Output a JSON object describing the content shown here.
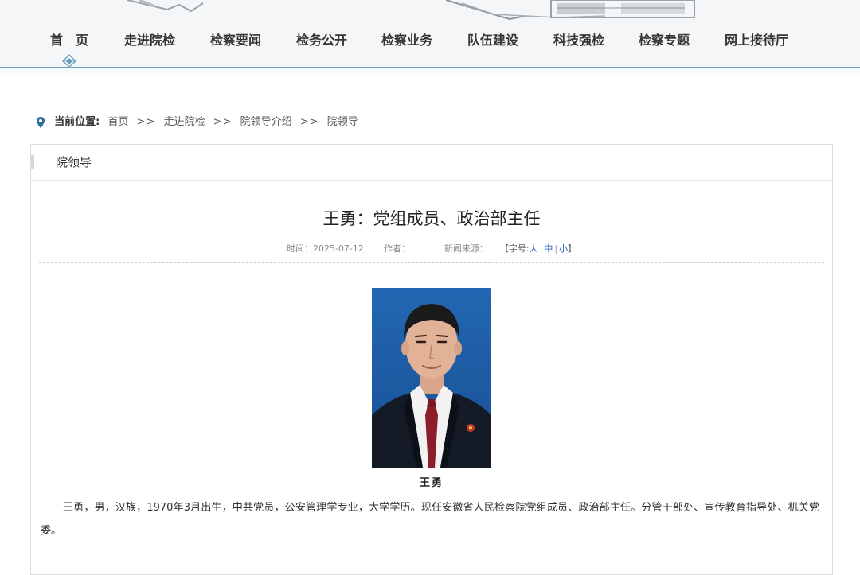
{
  "nav": {
    "items": [
      {
        "label": "首　页"
      },
      {
        "label": "走进院检"
      },
      {
        "label": "检察要闻"
      },
      {
        "label": "检务公开"
      },
      {
        "label": "检察业务"
      },
      {
        "label": "队伍建设"
      },
      {
        "label": "科技强检"
      },
      {
        "label": "检察专题"
      },
      {
        "label": "网上接待厅"
      }
    ]
  },
  "breadcrumb": {
    "label": "当前位置:",
    "items": [
      "首页",
      "走进院检",
      "院领导介绍",
      "院领导"
    ],
    "separator": ">>"
  },
  "panel": {
    "title": "院领导"
  },
  "article": {
    "title": "王勇：党组成员、政治部主任",
    "time_label": "时间：",
    "time": "2025-07-12",
    "author_label": "作者：",
    "source_label": "新闻来源：",
    "font_size_label": "【字号:",
    "font_size_large": "大",
    "font_size_medium": "中",
    "font_size_small": "小",
    "font_size_close": "】",
    "caption": "王勇",
    "bio": "王勇，男，汉族，1970年3月出生，中共党员，公安管理学专业，大学学历。现任安徽省人民检察院党组成员、政治部主任。分管干部处、宣传教育指导处、机关党委。"
  },
  "colors": {
    "nav_border": "#6a9ec0",
    "link_blue": "#2a62b8",
    "photo_bg": "#1f5ea8",
    "pin_icon": "#2d6f96"
  }
}
